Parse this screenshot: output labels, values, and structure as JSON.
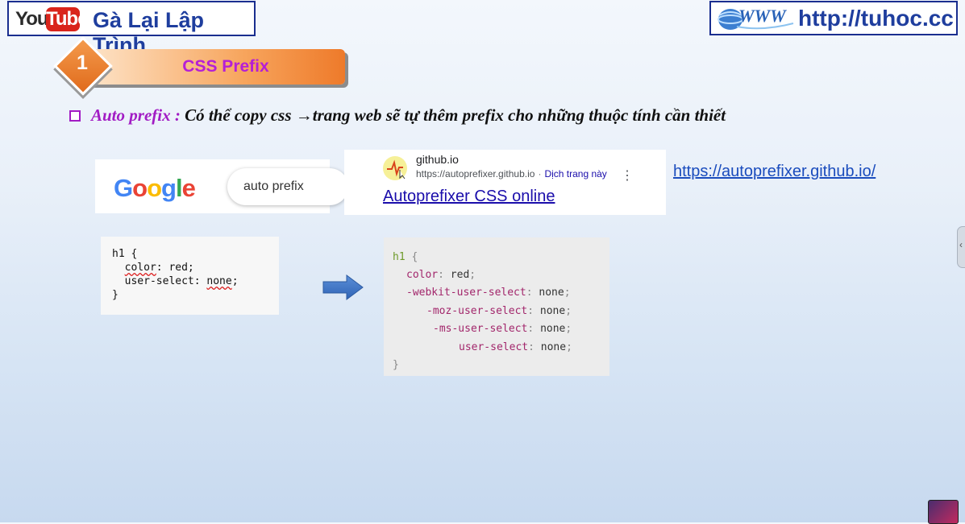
{
  "header": {
    "youtube_you": "You",
    "youtube_tube": "Tube",
    "channel_name": "Gà Lại Lập Trình",
    "site_logo_icon": "globe-www-icon",
    "site_url": "http://tuhoc.cc"
  },
  "section": {
    "number": "1",
    "title": "CSS Prefix"
  },
  "bullet": {
    "keyword": "Auto prefix :",
    "text_before_arrow": " Có thể copy css ",
    "arrow": "→",
    "text_after_arrow": "trang web sẽ tự thêm prefix cho những thuộc tính cần thiết"
  },
  "google": {
    "logo_letters": [
      "G",
      "o",
      "o",
      "g",
      "l",
      "e"
    ],
    "logo_colors": [
      "#4285F4",
      "#EA4335",
      "#FBBC05",
      "#4285F4",
      "#34A853",
      "#EA4335"
    ],
    "query": "auto prefix"
  },
  "result": {
    "domain": "github.io",
    "url": "https://autoprefixer.github.io",
    "separator": "·",
    "translate": "Dịch trang này",
    "menu": "⋮",
    "title": "Autoprefixer CSS online"
  },
  "side_link": "https://autoprefixer.github.io/",
  "code_input": {
    "line1": "h1 {",
    "line2_prop": "color",
    "line2_rest": ": red;",
    "line3_prop": "user-select",
    "line3_sep": ": ",
    "line3_val": "none",
    "line3_end": ";",
    "line4": "}"
  },
  "code_output": {
    "selector": "h1",
    "open": "{",
    "close": "}",
    "lines": [
      {
        "prop": "color",
        "val": "red"
      },
      {
        "prop": "-webkit-user-select",
        "val": "none"
      },
      {
        "prop": "-moz-user-select",
        "val": "none"
      },
      {
        "prop": "-ms-user-select",
        "val": "none"
      },
      {
        "prop": "user-select",
        "val": "none"
      }
    ]
  },
  "edge_tab": "‹",
  "colors": {
    "brand_blue": "#1f3e9e",
    "accent_purple": "#a21cc4",
    "banner_orange": "#ee7a2a"
  }
}
